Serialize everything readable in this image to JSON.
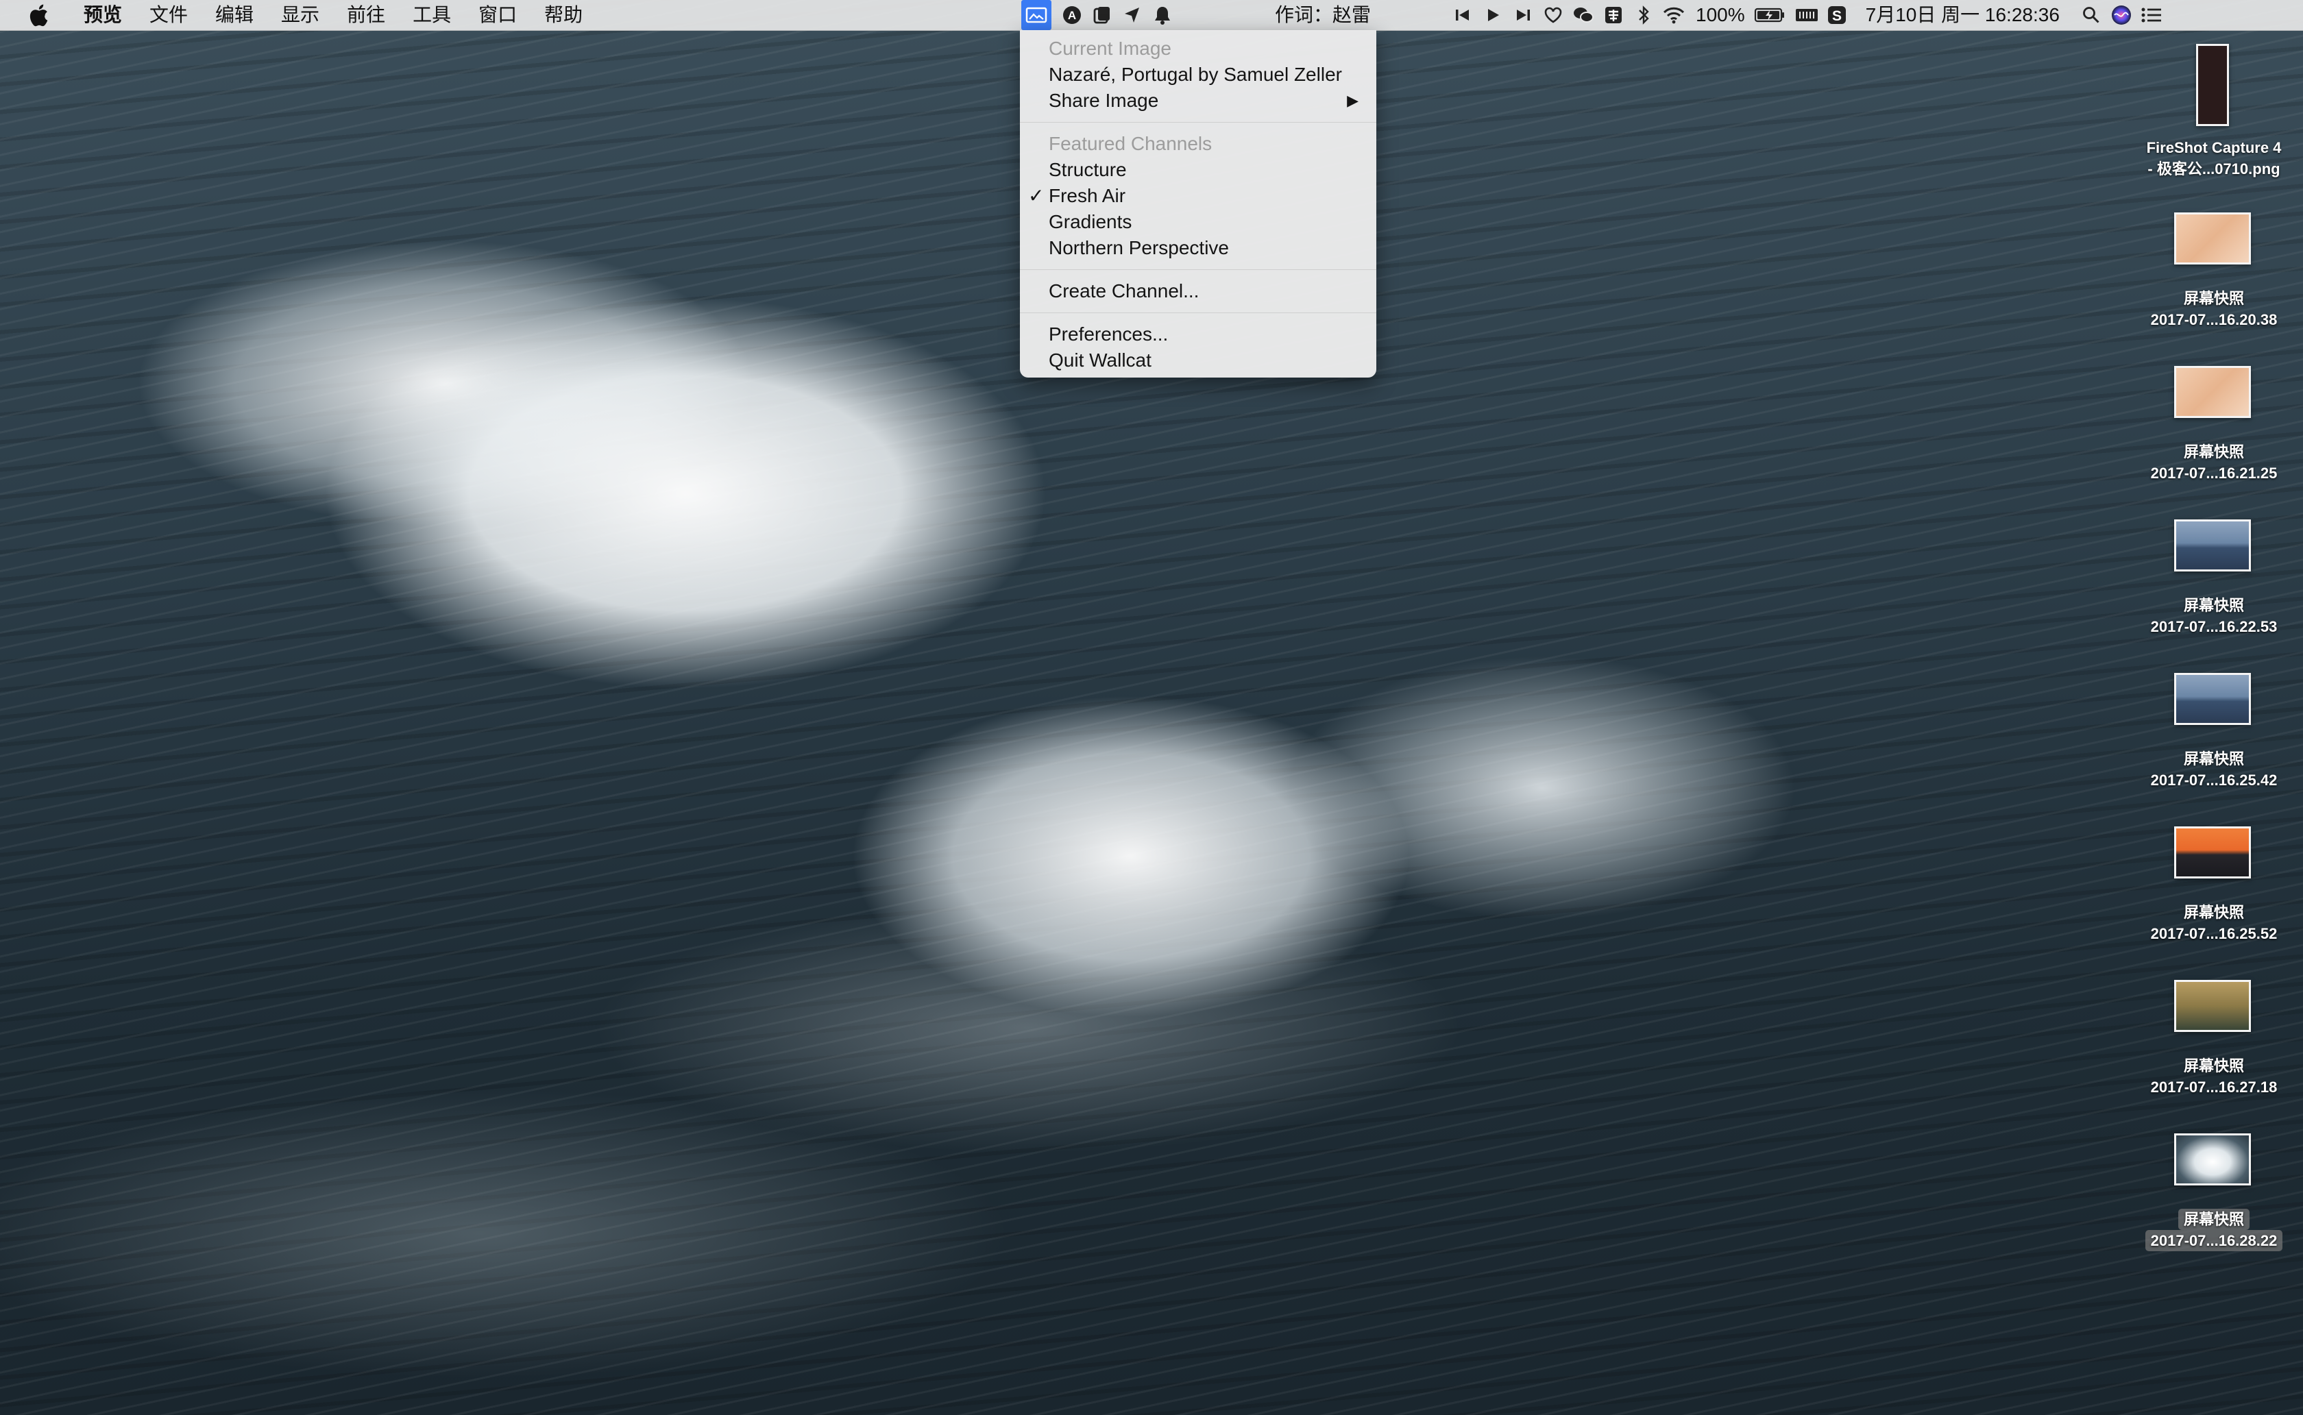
{
  "menubar": {
    "app_name": "预览",
    "items": [
      "文件",
      "编辑",
      "显示",
      "前往",
      "工具",
      "窗口",
      "帮助"
    ],
    "lyric_text": "作词：赵雷",
    "battery_text": "100%",
    "datetime_text": "7月10日 周一  16:28:36"
  },
  "dropdown": {
    "current_image_header": "Current Image",
    "current_image_title": "Nazaré, Portugal by Samuel Zeller",
    "share_image_label": "Share Image",
    "featured_header": "Featured Channels",
    "channels": [
      "Structure",
      "Fresh Air",
      "Gradients",
      "Northern Perspective"
    ],
    "checked_channel": "Fresh Air",
    "create_channel_label": "Create Channel...",
    "preferences_label": "Preferences...",
    "quit_label": "Quit Wallcat"
  },
  "desktop_icons": [
    {
      "line1": "FireShot Capture 4",
      "line2": "- 极客公...0710.png"
    },
    {
      "line1": "屏幕快照",
      "line2": "2017-07...16.20.38"
    },
    {
      "line1": "屏幕快照",
      "line2": "2017-07...16.21.25"
    },
    {
      "line1": "屏幕快照",
      "line2": "2017-07...16.22.53"
    },
    {
      "line1": "屏幕快照",
      "line2": "2017-07...16.25.42"
    },
    {
      "line1": "屏幕快照",
      "line2": "2017-07...16.25.52"
    },
    {
      "line1": "屏幕快照",
      "line2": "2017-07...16.27.18"
    },
    {
      "line1": "屏幕快照",
      "line2": "2017-07...16.28.22"
    }
  ],
  "colors": {
    "menubar_bg": "#e8e8e8",
    "active_status_icon": "#3a7bf4",
    "disabled_text": "#9c9c9c"
  }
}
